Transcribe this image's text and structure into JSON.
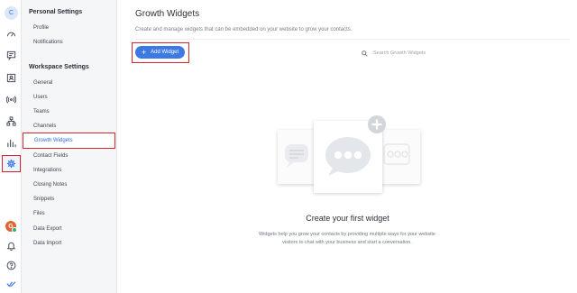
{
  "rail": {
    "avatar_letter": "C",
    "user_avatar_letter": "G",
    "icons": [
      "dashboard-icon",
      "conversations-icon",
      "contacts-icon",
      "broadcast-icon",
      "workflows-icon",
      "reports-icon",
      "settings-icon",
      "notifications-icon",
      "help-icon",
      "logo-icon"
    ]
  },
  "sidebar": {
    "personal_heading": "Personal Settings",
    "personal_items": [
      {
        "label": "Profile"
      },
      {
        "label": "Notifications"
      }
    ],
    "workspace_heading": "Workspace Settings",
    "workspace_items": [
      {
        "label": "General"
      },
      {
        "label": "Users"
      },
      {
        "label": "Teams"
      },
      {
        "label": "Channels"
      },
      {
        "label": "Growth Widgets"
      },
      {
        "label": "Contact Fields"
      },
      {
        "label": "Integrations"
      },
      {
        "label": "Closing Notes"
      },
      {
        "label": "Snippets"
      },
      {
        "label": "Files"
      },
      {
        "label": "Data Export"
      },
      {
        "label": "Data Import"
      }
    ]
  },
  "main": {
    "title": "Growth Widgets",
    "subtitle": "Create and manage widgets that can be embedded on your website to grow your contacts.",
    "add_button_label": "Add Widget",
    "search_placeholder": "Search Growth Widgets",
    "empty_title": "Create your first widget",
    "empty_description": "Widgets help you grow your contacts by providing multiple ways for your website visitors to chat with your business and start a conversation."
  },
  "colors": {
    "accent": "#3d79e3",
    "highlight": "#d9232d",
    "sidebar_bg": "#f5f6f8"
  }
}
